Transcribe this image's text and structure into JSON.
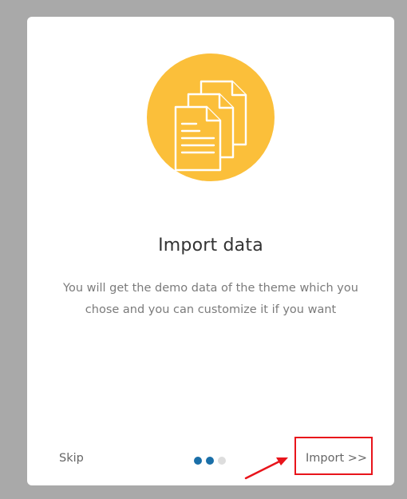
{
  "onboarding": {
    "title": "Import data",
    "description": "You will get the demo data of the theme which you chose and you can customize it if you want",
    "skip_label": "Skip",
    "import_label": "Import >>",
    "icon": "documents-icon",
    "step_total": 3,
    "step_current": 2
  },
  "colors": {
    "accent_circle": "#fbbf3a",
    "dot_active": "#1a6fa8",
    "dot_inactive": "#dddddd",
    "highlight": "#e8141b"
  }
}
